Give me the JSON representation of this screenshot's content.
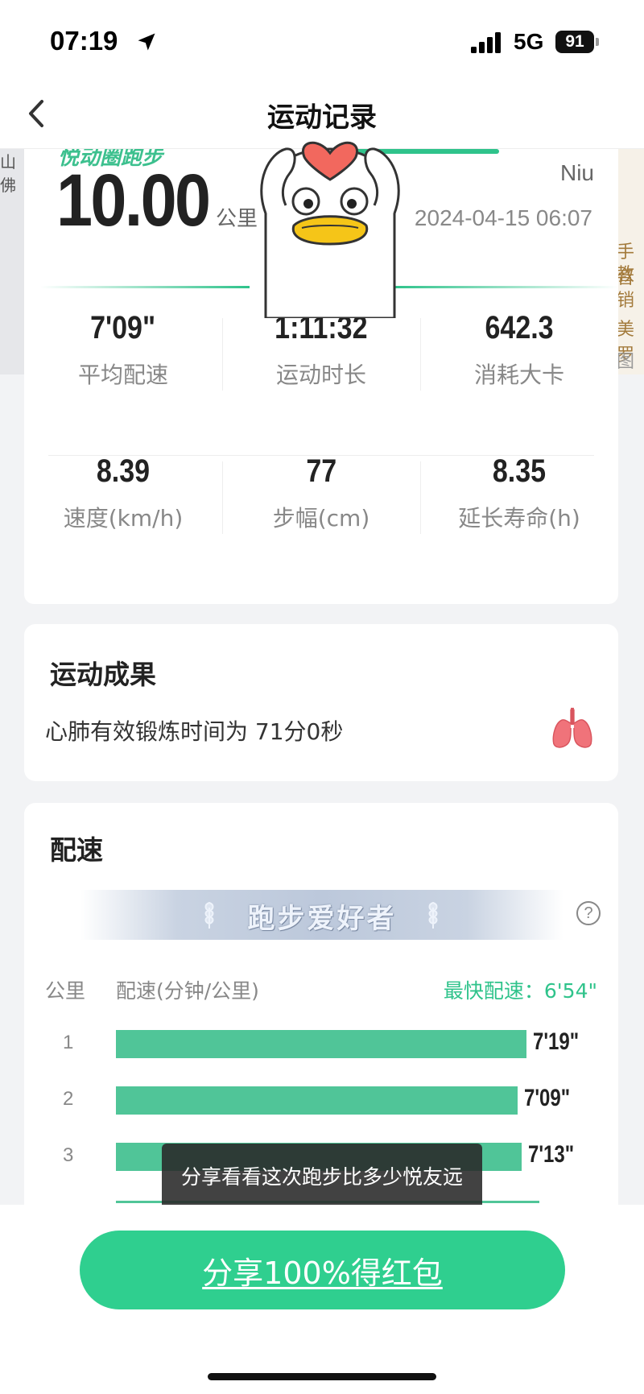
{
  "status_bar": {
    "time": "07:19",
    "network": "5G",
    "battery": "91"
  },
  "nav": {
    "title": "运动记录"
  },
  "summary": {
    "brand": "悦动圈跑步",
    "distance": "10.00",
    "unit": "公里",
    "username": "Niu",
    "datetime": "2024-04-15 06:07",
    "stats": [
      {
        "value": "7'09\"",
        "label": "平均配速"
      },
      {
        "value": "1:11:32",
        "label": "运动时长"
      },
      {
        "value": "642.3",
        "label": "消耗大卡"
      },
      {
        "value": "8.39",
        "label": "速度(km/h)"
      },
      {
        "value": "77",
        "label": "步幅(cm)"
      },
      {
        "value": "8.35",
        "label": "延长寿命(h)"
      }
    ]
  },
  "achievement": {
    "title": "运动成果",
    "desc": "心肺有效锻炼时间为 71分0秒",
    "icon": "lungs-icon"
  },
  "pace": {
    "title": "配速",
    "banner": "跑步爱好者",
    "col_km": "公里",
    "col_pace": "配速(分钟/公里)",
    "fastest": "最快配速：6'54\"",
    "rows": [
      {
        "km": "1",
        "pace": "7'19\"",
        "fraction": 0.98
      },
      {
        "km": "2",
        "pace": "7'09\"",
        "fraction": 0.96
      },
      {
        "km": "3",
        "pace": "7'13\"",
        "fraction": 0.97
      }
    ]
  },
  "toast": "分享看看这次跑步比多少悦友远",
  "share_button": "分享100%得红包",
  "background": {
    "left_text": [
      "山佛",
      "（"
    ],
    "right_text": [
      "手音",
      "教销",
      "美罗",
      "图"
    ]
  },
  "colors": {
    "accent": "#2fcf8f",
    "bar": "#50c598",
    "fastest": "#2fc38b"
  }
}
